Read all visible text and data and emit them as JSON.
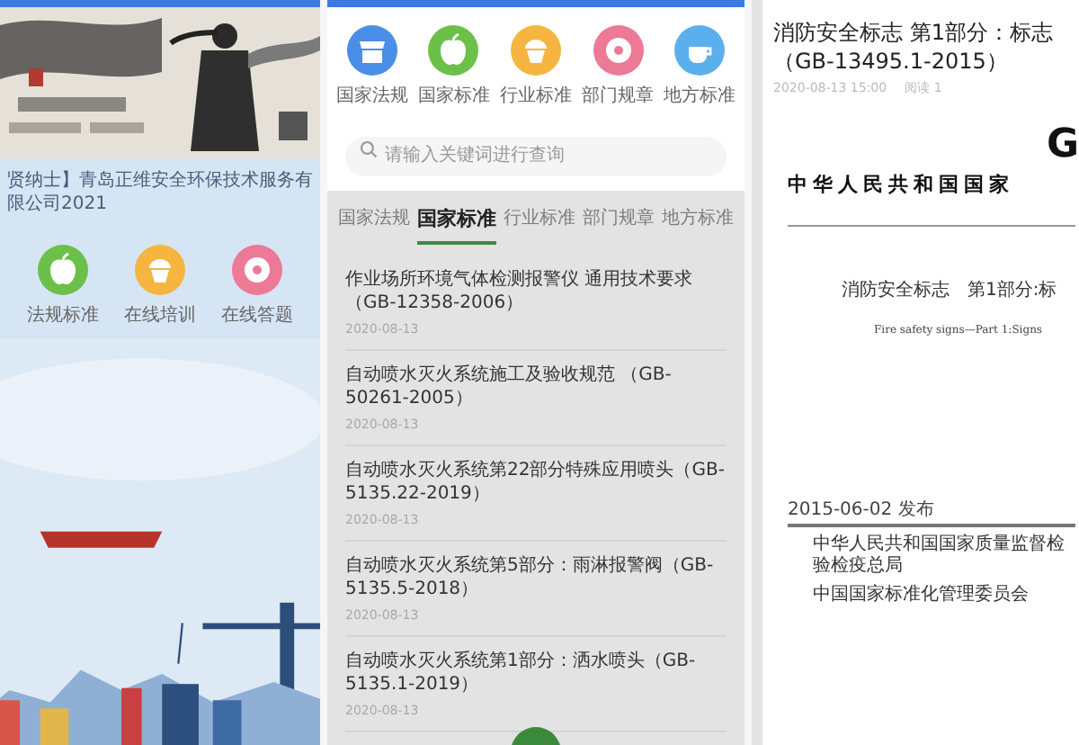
{
  "home": {
    "marquee": "贤纳士】青岛正维安全环保技术服务有限公司2021",
    "shortcuts": [
      {
        "label": "法规标准",
        "color": "#6cc04a",
        "kind": "apple"
      },
      {
        "label": "在线培训",
        "color": "#f5b540",
        "kind": "cupcake"
      },
      {
        "label": "在线答题",
        "color": "#ec7a96",
        "kind": "donut"
      }
    ]
  },
  "standards": {
    "categories": [
      {
        "label": "国家法规",
        "color": "#4a8ee8",
        "kind": "store"
      },
      {
        "label": "国家标准",
        "color": "#6cc04a",
        "kind": "apple"
      },
      {
        "label": "行业标准",
        "color": "#f5b540",
        "kind": "cupcake"
      },
      {
        "label": "部门规章",
        "color": "#ec7a96",
        "kind": "donut"
      },
      {
        "label": "地方标准",
        "color": "#5ab0ec",
        "kind": "cup"
      }
    ],
    "search": {
      "placeholder": "请输入关键词进行查询"
    },
    "tabs": [
      {
        "label": "国家法规",
        "selected": false
      },
      {
        "label": "国家标准",
        "selected": true
      },
      {
        "label": "行业标准",
        "selected": false
      },
      {
        "label": "部门规章",
        "selected": false
      },
      {
        "label": "地方标准",
        "selected": false
      }
    ],
    "items": [
      {
        "title": "作业场所环境气体检测报警仪 通用技术要求（GB-12358-2006）",
        "date": "2020-08-13"
      },
      {
        "title": "自动喷水灭火系统施工及验收规范 （GB-50261-2005）",
        "date": "2020-08-13"
      },
      {
        "title": "自动喷水灭火系统第22部分特殊应用喷头（GB-5135.22-2019）",
        "date": "2020-08-13"
      },
      {
        "title": "自动喷水灭火系统第5部分：雨淋报警阀（GB-5135.5-2018）",
        "date": "2020-08-13"
      },
      {
        "title": "自动喷水灭火系统第1部分：洒水喷头（GB-5135.1-2019）",
        "date": "2020-08-13"
      }
    ]
  },
  "article": {
    "title": "消防安全标志 第1部分：标志（GB-13495.1-2015）",
    "time": "2020-08-13 15:00",
    "reads": "阅读 1",
    "document": {
      "logo": "G",
      "country": "中华人民共和国国家",
      "standard_title": "消防安全标志　第1部分:标",
      "english_title": "Fire safety signs—Part 1:Signs",
      "issue_date": "2015-06-02 发布",
      "issuers": [
        "中华人民共和国国家质量监督检验检疫总局",
        "中国国家标准化管理委员会"
      ]
    }
  }
}
